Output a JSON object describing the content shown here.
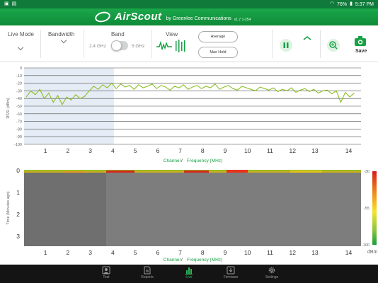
{
  "status_bar": {
    "battery": "76%",
    "time": "5:37 PM"
  },
  "app": {
    "brand": "AirScout",
    "by": "by Greenlee Communications",
    "version": "v1.7.1-254"
  },
  "toolbar": {
    "mode_label": "Live Mode",
    "bandwidth_label": "Bandwidth",
    "band_label": "Band",
    "band_24": "2.4 GHz",
    "band_5": "5 GHz",
    "view_label": "View",
    "average_label": "Average",
    "maxhold_label": "Max Hold",
    "save_label": "Save"
  },
  "colors": {
    "accent": "#16a245",
    "brand_bar": "#13963f",
    "status_bar": "#0f7a3a",
    "trace": "#8cbf26"
  },
  "top_chart": {
    "ylabel": "RSSI (dBm)",
    "yticks": [
      "0",
      "-10",
      "-20",
      "-30",
      "-40",
      "-50",
      "-60",
      "-70",
      "-80",
      "-90",
      "-100"
    ],
    "caption_a": "Channel",
    "caption_sep": " / ",
    "caption_b": "Frequency (MHz)"
  },
  "bottom_chart": {
    "ylabel": "Time (Minutes ago)",
    "yticks": [
      "0",
      "1",
      "2",
      "3"
    ],
    "caption_a": "Channel",
    "caption_sep": " / ",
    "caption_b": "Frequency (MHz)",
    "scale_top": "-30",
    "scale_mid": "-55",
    "scale_bottom": "-100",
    "scale_unit": "dBm"
  },
  "channels": [
    "1",
    "2",
    "3",
    "4",
    "5",
    "6",
    "7",
    "8",
    "9",
    "10",
    "11",
    "12",
    "13",
    "14"
  ],
  "chart_data": {
    "type": "line",
    "ylabel": "RSSI (dBm)",
    "xlabel": "Channel / Frequency (MHz)",
    "ylim": [
      -100,
      0
    ],
    "xlim": [
      0,
      15
    ],
    "highlight_channels": [
      1,
      4
    ],
    "series": [
      {
        "x": [
          0.1,
          0.3,
          0.5,
          0.7,
          0.9,
          1.1,
          1.3,
          1.5,
          1.7,
          1.9,
          2.1,
          2.3,
          2.5,
          2.7,
          2.9,
          3.1,
          3.3,
          3.5,
          3.7,
          3.9,
          4.1,
          4.3,
          4.5,
          4.7,
          4.9,
          5.1,
          5.3,
          5.5,
          5.7,
          5.9,
          6.1,
          6.3,
          6.5,
          6.7,
          6.9,
          7.1,
          7.3,
          7.5,
          7.7,
          7.9,
          8.1,
          8.3,
          8.5,
          8.7,
          8.9,
          9.1,
          9.3,
          9.5,
          9.7,
          9.9,
          10.1,
          10.3,
          10.5,
          10.7,
          10.9,
          11.1,
          11.3,
          11.5,
          11.7,
          11.9,
          12.1,
          12.3,
          12.5,
          12.7,
          12.9,
          13.1,
          13.3,
          13.5,
          13.7,
          13.9,
          14.1,
          14.3,
          14.5,
          14.7
        ],
        "y": [
          -38,
          -30,
          -35,
          -28,
          -40,
          -33,
          -45,
          -36,
          -48,
          -38,
          -42,
          -35,
          -40,
          -37,
          -30,
          -24,
          -28,
          -22,
          -26,
          -20,
          -27,
          -21,
          -25,
          -23,
          -28,
          -22,
          -26,
          -24,
          -21,
          -27,
          -23,
          -25,
          -29,
          -24,
          -26,
          -22,
          -28,
          -25,
          -23,
          -27,
          -24,
          -26,
          -21,
          -28,
          -25,
          -23,
          -27,
          -29,
          -24,
          -26,
          -28,
          -30,
          -25,
          -27,
          -29,
          -26,
          -31,
          -28,
          -30,
          -26,
          -32,
          -29,
          -27,
          -31,
          -28,
          -33,
          -30,
          -29,
          -34,
          -30,
          -45,
          -32,
          -38,
          -33
        ]
      }
    ]
  },
  "nav": [
    {
      "label": "Test",
      "icon": "person-icon"
    },
    {
      "label": "Reports",
      "icon": "document-icon"
    },
    {
      "label": "Live",
      "icon": "bar-chart-icon"
    },
    {
      "label": "Firmware",
      "icon": "download-icon"
    },
    {
      "label": "Settings",
      "icon": "gear-icon"
    }
  ]
}
